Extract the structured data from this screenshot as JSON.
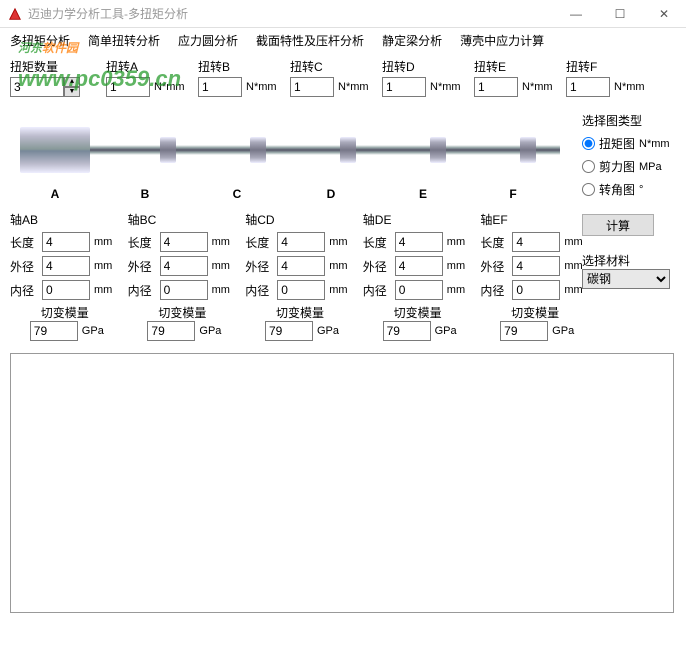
{
  "window": {
    "title": "迈迪力学分析工具-多扭矩分析",
    "min": "—",
    "max": "☐",
    "close": "✕"
  },
  "menu": [
    "多扭矩分析",
    "简单扭转分析",
    "应力圆分析",
    "截面特性及压杆分析",
    "静定梁分析",
    "薄壳中应力计算"
  ],
  "watermark": {
    "a": "河东",
    "b": "软件园",
    "url": "www.pc0359.cn"
  },
  "count": {
    "label": "扭矩数量",
    "value": "3"
  },
  "torques": [
    {
      "label": "扭转A",
      "value": "1",
      "unit": "N*mm"
    },
    {
      "label": "扭转B",
      "value": "1",
      "unit": "N*mm"
    },
    {
      "label": "扭转C",
      "value": "1",
      "unit": "N*mm"
    },
    {
      "label": "扭转D",
      "value": "1",
      "unit": "N*mm"
    },
    {
      "label": "扭转E",
      "value": "1",
      "unit": "N*mm"
    },
    {
      "label": "扭转F",
      "value": "1",
      "unit": "N*mm"
    }
  ],
  "chartType": {
    "title": "选择图类型",
    "options": [
      {
        "label": "扭矩图",
        "unit": "N*mm",
        "checked": true
      },
      {
        "label": "剪力图",
        "unit": "MPa",
        "checked": false
      },
      {
        "label": "转角图",
        "unit": "°",
        "checked": false
      }
    ]
  },
  "calc": "计算",
  "letters": [
    "A",
    "B",
    "C",
    "D",
    "E",
    "F"
  ],
  "material": {
    "label": "选择材料",
    "value": "碳钢"
  },
  "segLabels": {
    "len": "长度",
    "od": "外径",
    "id": "内径",
    "shear": "切变模量",
    "mm": "mm",
    "gpa": "GPa"
  },
  "segments": [
    {
      "name": "轴AB",
      "len": "4",
      "od": "4",
      "id": "0",
      "g": "79"
    },
    {
      "name": "轴BC",
      "len": "4",
      "od": "4",
      "id": "0",
      "g": "79"
    },
    {
      "name": "轴CD",
      "len": "4",
      "od": "4",
      "id": "0",
      "g": "79"
    },
    {
      "name": "轴DE",
      "len": "4",
      "od": "4",
      "id": "0",
      "g": "79"
    },
    {
      "name": "轴EF",
      "len": "4",
      "od": "4",
      "id": "0",
      "g": "79"
    }
  ]
}
